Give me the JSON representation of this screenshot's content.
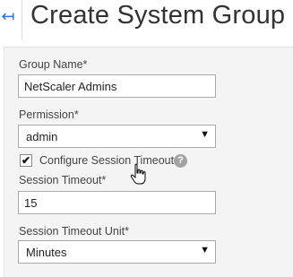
{
  "header": {
    "back_glyph": "↤",
    "title": "Create System Group"
  },
  "form": {
    "group_name": {
      "label": "Group Name*",
      "value": "NetScaler Admins"
    },
    "permission": {
      "label": "Permission*",
      "value": "admin"
    },
    "configure_timeout": {
      "label": "Configure Session Timeout",
      "checked": true,
      "check_glyph": "✔",
      "help_glyph": "?"
    },
    "session_timeout": {
      "label": "Session Timeout*",
      "value": "15"
    },
    "timeout_unit": {
      "label": "Session Timeout Unit*",
      "value": "Minutes"
    }
  },
  "icons": {
    "back": "back-arrow-icon",
    "caret": "chevron-down-icon",
    "help": "help-icon",
    "cursor": "hand-pointer-icon"
  },
  "colors": {
    "accent": "#2a77c9",
    "panel_bg": "#f4f4f4",
    "input_border": "#a9a9a9"
  }
}
